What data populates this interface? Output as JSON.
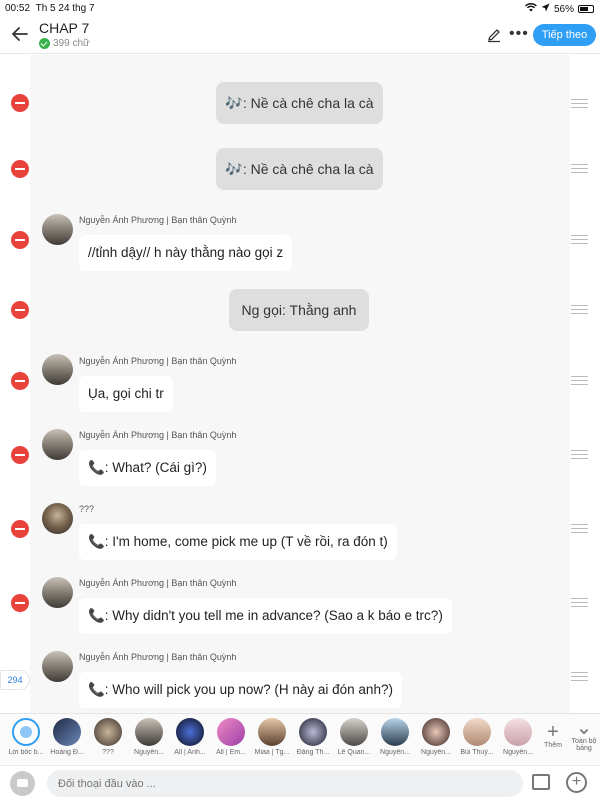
{
  "status": {
    "time": "00:52",
    "date": "Th 5 24 thg 7",
    "battery": "56%"
  },
  "header": {
    "title": "CHAP 7",
    "subtitle": "399 chữ",
    "next_label": "Tiếp theo"
  },
  "messages": [
    {
      "type": "narration",
      "text": "🎶: Nề cà chê cha la cà"
    },
    {
      "type": "narration",
      "text": "🎶: Nề cà chê cha la cà"
    },
    {
      "type": "chat",
      "name": "Nguyễn Ánh Phương | Bạn thân Quỳnh",
      "text": "//tỉnh dậy// h này thằng nào gọi z"
    },
    {
      "type": "narration",
      "text": "Ng gọi: Thằng anh"
    },
    {
      "type": "chat",
      "name": "Nguyễn Ánh Phương | Bạn thân Quỳnh",
      "text": "Ụa, gọi chi tr"
    },
    {
      "type": "chat",
      "name": "Nguyễn Ánh Phương | Bạn thân Quỳnh",
      "text": "📞: What? (Cái gì?)"
    },
    {
      "type": "chat",
      "name": "???",
      "text": "📞: I'm home, come pick me up (T về rồi, ra đón t)"
    },
    {
      "type": "chat",
      "name": "Nguyễn Ánh Phương | Bạn thân Quỳnh",
      "text": "📞: Why didn't you tell me in advance? (Sao a k báo e trc?)"
    },
    {
      "type": "chat",
      "name": "Nguyễn Ánh Phương | Bạn thân Quỳnh",
      "text": "📞: Who will pick you up now? (H này ai đón anh?)"
    }
  ],
  "message_count": "294",
  "characters": [
    "Lời bốc b...",
    "Hoàng Đ...",
    "???",
    "Nguyễn...",
    "All | Anh...",
    "All | Em...",
    "Miaa | Tg...",
    "Đặng Th...",
    "Lê Quan...",
    "Nguyễn...",
    "Nguyễn...",
    "Bùi Thuỳ...",
    "Nguyễn..."
  ],
  "char_actions": {
    "add": "Thêm",
    "all": "Toàn bộ bảng"
  },
  "input": {
    "placeholder": "Đối thoại đầu vào ..."
  }
}
